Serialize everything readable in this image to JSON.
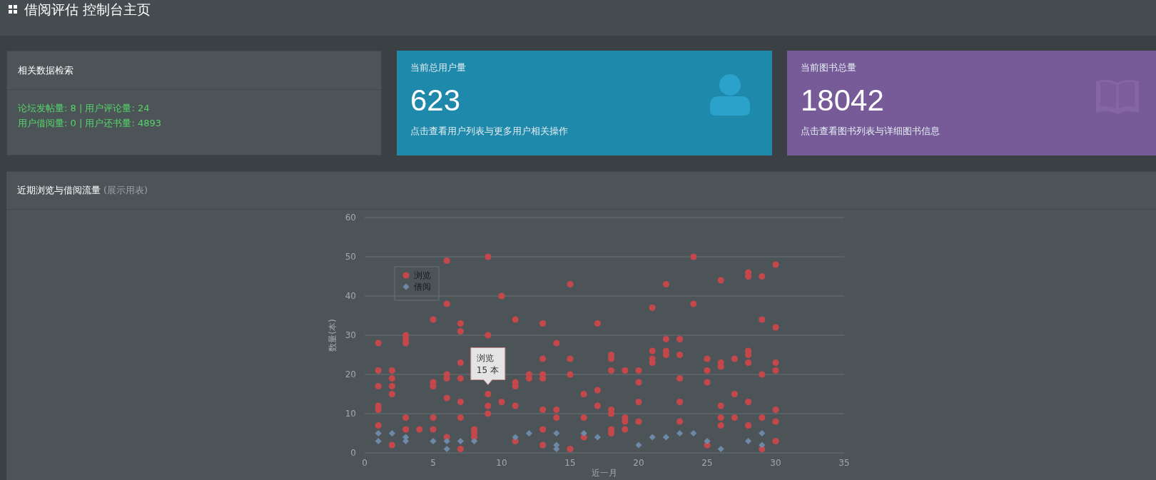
{
  "header": {
    "title": "借阅评估 控制台主页"
  },
  "search_panel": {
    "title": "相关数据检索",
    "lines": [
      "论坛发帖量: 8 | 用户评论量: 24",
      "用户借阅量: 0 | 用户还书量: 4893"
    ]
  },
  "stat_cards": [
    {
      "kind": "users",
      "color": "#1f89ab",
      "label": "当前总用户量",
      "value": "623",
      "description": "点击查看用户列表与更多用户相关操作"
    },
    {
      "kind": "books",
      "color": "#775b98",
      "label": "当前图书总量",
      "value": "18042",
      "description": "点击查看图书列表与详细图书信息"
    }
  ],
  "traffic_panel": {
    "title": "近期浏览与借阅流量",
    "subtitle": "(展示用表)",
    "chart_data": {
      "type": "scatter",
      "xlabel": "近一月",
      "ylabel": "数量(本)",
      "xlim": [
        0,
        35
      ],
      "ylim": [
        0,
        60
      ],
      "xticks": [
        0,
        5,
        10,
        15,
        20,
        25,
        30,
        35
      ],
      "yticks": [
        0,
        10,
        20,
        30,
        40,
        50,
        60
      ],
      "grid": true,
      "legend": "upper left",
      "x": [
        1,
        1,
        1,
        1,
        1,
        1,
        2,
        2,
        2,
        2,
        2,
        3,
        3,
        3,
        3,
        3,
        4,
        5,
        5,
        5,
        5,
        5,
        6,
        6,
        6,
        6,
        6,
        6,
        7,
        7,
        7,
        7,
        7,
        7,
        7,
        8,
        8,
        8,
        9,
        9,
        9,
        9,
        9,
        10,
        10,
        11,
        11,
        11,
        11,
        11,
        12,
        12,
        13,
        13,
        13,
        13,
        13,
        13,
        13,
        14,
        14,
        14,
        15,
        15,
        15,
        15,
        16,
        16,
        16,
        17,
        17,
        17,
        18,
        18,
        18,
        18,
        18,
        18,
        18,
        19,
        19,
        19,
        19,
        20,
        20,
        20,
        20,
        21,
        21,
        21,
        21,
        22,
        22,
        22,
        22,
        23,
        23,
        23,
        23,
        23,
        24,
        24,
        25,
        25,
        25,
        25,
        26,
        26,
        26,
        26,
        26,
        26,
        27,
        27,
        27,
        28,
        28,
        28,
        28,
        28,
        28,
        28,
        29,
        29,
        29,
        29,
        29,
        30,
        30,
        30,
        30,
        30,
        30,
        30
      ],
      "series": [
        {
          "name": "浏览",
          "color": "#c3474b",
          "values": [
            28,
            21,
            17,
            12,
            11,
            7,
            21,
            19,
            17,
            15,
            2,
            30,
            29,
            28,
            9,
            6,
            6,
            34,
            18,
            17,
            9,
            6,
            49,
            38,
            20,
            19,
            14,
            4,
            33,
            31,
            23,
            19,
            13,
            9,
            1,
            6,
            5,
            4,
            50,
            30,
            15,
            12,
            10,
            40,
            13,
            34,
            18,
            17,
            12,
            3,
            20,
            19,
            33,
            24,
            20,
            19,
            11,
            6,
            2,
            28,
            11,
            9,
            43,
            24,
            20,
            1,
            15,
            9,
            4,
            33,
            16,
            12,
            25,
            24,
            21,
            11,
            10,
            6,
            5,
            21,
            9,
            8,
            6,
            21,
            18,
            13,
            8,
            37,
            26,
            24,
            23,
            43,
            29,
            26,
            25,
            29,
            25,
            19,
            13,
            8,
            50,
            38,
            24,
            21,
            18,
            2,
            44,
            23,
            22,
            12,
            9,
            7,
            24,
            15,
            9,
            46,
            45,
            26,
            25,
            23,
            13,
            7,
            45,
            34,
            20,
            9,
            1,
            48,
            32,
            23,
            21,
            11,
            8,
            3
          ]
        },
        {
          "name": "借阅",
          "color": "#6d89a8",
          "values": [
            5,
            3,
            null,
            null,
            null,
            null,
            5,
            null,
            null,
            null,
            null,
            4,
            3,
            null,
            null,
            null,
            null,
            3,
            null,
            null,
            null,
            null,
            3,
            1,
            null,
            null,
            null,
            null,
            3,
            null,
            null,
            null,
            null,
            null,
            null,
            3,
            null,
            null,
            null,
            null,
            null,
            null,
            null,
            null,
            null,
            4,
            null,
            null,
            null,
            null,
            5,
            null,
            null,
            null,
            null,
            null,
            null,
            null,
            null,
            5,
            2,
            1,
            null,
            null,
            null,
            null,
            5,
            null,
            null,
            4,
            null,
            null,
            null,
            null,
            null,
            null,
            null,
            null,
            null,
            null,
            null,
            null,
            null,
            2,
            null,
            null,
            null,
            4,
            null,
            null,
            null,
            4,
            null,
            null,
            null,
            5,
            null,
            null,
            null,
            null,
            5,
            null,
            3,
            null,
            null,
            null,
            1,
            null,
            null,
            null,
            null,
            null,
            null,
            null,
            null,
            3,
            null,
            null,
            null,
            null,
            null,
            null,
            5,
            2,
            null,
            null,
            null,
            null,
            null,
            null,
            null,
            null,
            null,
            null
          ]
        }
      ],
      "annotations": [
        {
          "x": 9,
          "y": 15,
          "text": "浏览\n15 本"
        }
      ]
    }
  }
}
